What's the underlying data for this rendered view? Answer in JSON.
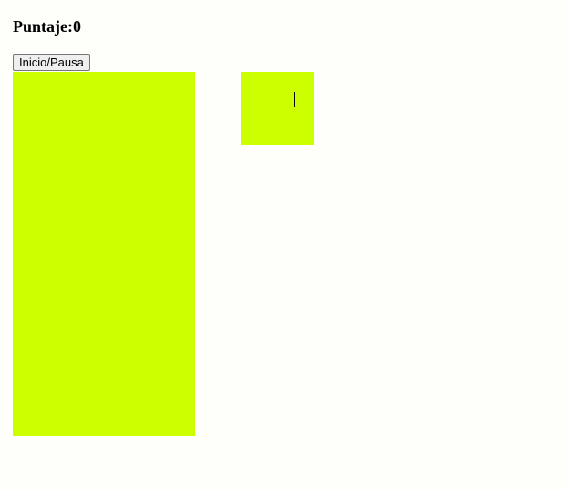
{
  "score": {
    "label": "Puntaje:",
    "value": "0"
  },
  "controls": {
    "start_pause_label": "Inicio/Pausa"
  },
  "colors": {
    "page_background": "#fefefb",
    "board_background": "#ccff00",
    "next_piece_background": "#ccff00",
    "text": "#000000"
  }
}
